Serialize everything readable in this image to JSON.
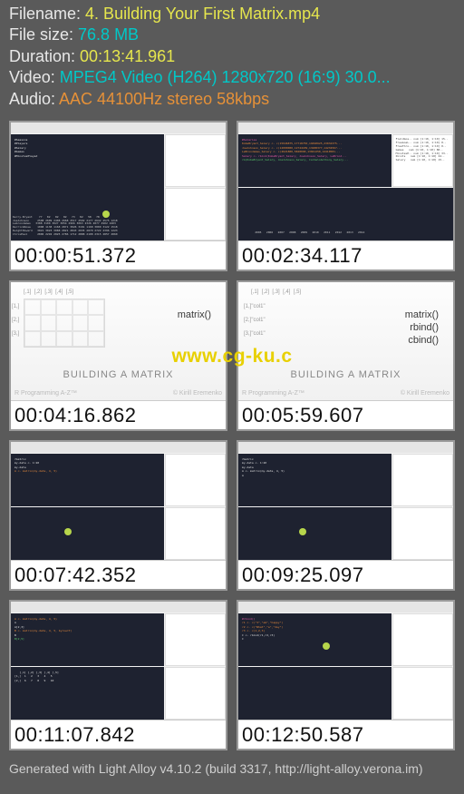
{
  "info": {
    "filename_label": "Filename: ",
    "filename": "4. Building Your First Matrix.mp4",
    "filesize_label": "File size: ",
    "filesize": "76.8 MB",
    "duration_label": "Duration: ",
    "duration": "00:13:41.961",
    "video_label": "Video: ",
    "video": "MPEG4 Video (H264) 1280x720 (16:9) 30.0...",
    "audio_label": "Audio: ",
    "audio": "AAC 44100Hz stereo 58kbps"
  },
  "thumbs": [
    {
      "ts": "00:00:51.372"
    },
    {
      "ts": "00:02:34.117"
    },
    {
      "ts": "00:04:16.862"
    },
    {
      "ts": "00:05:59.607"
    },
    {
      "ts": "00:07:42.352"
    },
    {
      "ts": "00:09:25.097"
    },
    {
      "ts": "00:11:07.842"
    },
    {
      "ts": "00:12:50.587"
    }
  ],
  "slide": {
    "func1": "matrix()",
    "func2": "rbind()",
    "func3": "cbind()",
    "title": "BUILDING A MATRIX",
    "foot_l": "R Programming A-Z™",
    "foot_r": "© Kirill Eremenko",
    "hdr1": "[,1]",
    "hdr2": "[,2]",
    "hdr3": "[,3]",
    "hdr4": "[,4]",
    "hdr5": "[,5]",
    "row1": "[1,]",
    "row2": "[2,]",
    "row3": "[3,]",
    "row1b": "[1,]\"col1\"",
    "row2b": "[2,]\"col1\"",
    "row3b": "[3,]\"col1\""
  },
  "watermark": "www.cg-ku.c",
  "footer": "Generated with Light Alloy v4.10.2 (build 3317, http://light-alloy.verona.im)"
}
